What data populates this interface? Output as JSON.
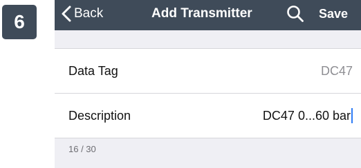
{
  "step": {
    "number": "6"
  },
  "navbar": {
    "back_label": "Back",
    "title": "Add Transmitter",
    "save_label": "Save",
    "background_color": "#3f4b59",
    "icons": [
      "chevron-left-icon",
      "search-icon"
    ]
  },
  "form": {
    "data_tag": {
      "label": "Data Tag",
      "placeholder": "DC47"
    },
    "description": {
      "label": "Description",
      "value": "DC47 0...60 bar"
    },
    "counter": "16 / 30"
  }
}
